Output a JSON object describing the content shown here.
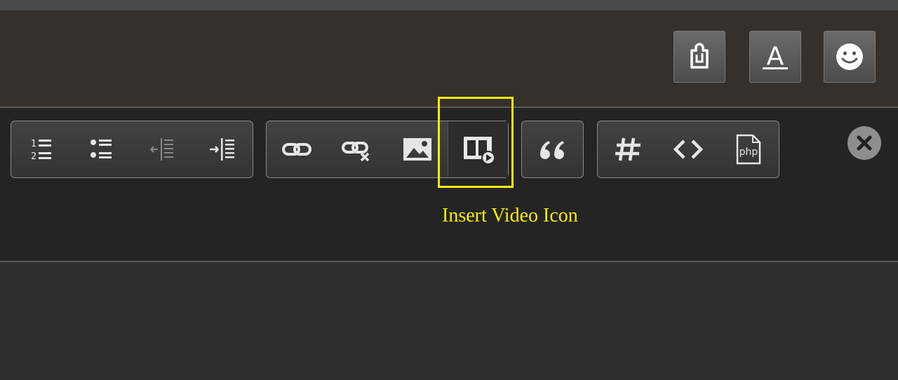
{
  "top_toolbar": {
    "buttons": [
      {
        "icon": "clipboard-paste-icon"
      },
      {
        "icon": "font-color-icon",
        "glyph": "A"
      },
      {
        "icon": "smiley-icon"
      }
    ]
  },
  "editor_toolbar": {
    "groups": [
      {
        "name": "lists",
        "buttons": [
          "ordered-list-icon",
          "unordered-list-icon",
          "outdent-icon",
          "indent-icon"
        ]
      },
      {
        "name": "media",
        "buttons": [
          "link-icon",
          "unlink-icon",
          "image-icon",
          "video-icon"
        ]
      },
      {
        "name": "quote",
        "buttons": [
          "quote-icon"
        ]
      },
      {
        "name": "code",
        "buttons": [
          "hash-icon",
          "code-icon",
          "php-icon"
        ],
        "php_label": "php"
      }
    ],
    "close_icon": "close-icon"
  },
  "annotation": {
    "text": "Insert Video Icon",
    "color": "#ffef00"
  },
  "colors": {
    "icon": "#e6e6e6",
    "icon_disabled": "#8a8a8a",
    "highlight": "#ffef00"
  }
}
